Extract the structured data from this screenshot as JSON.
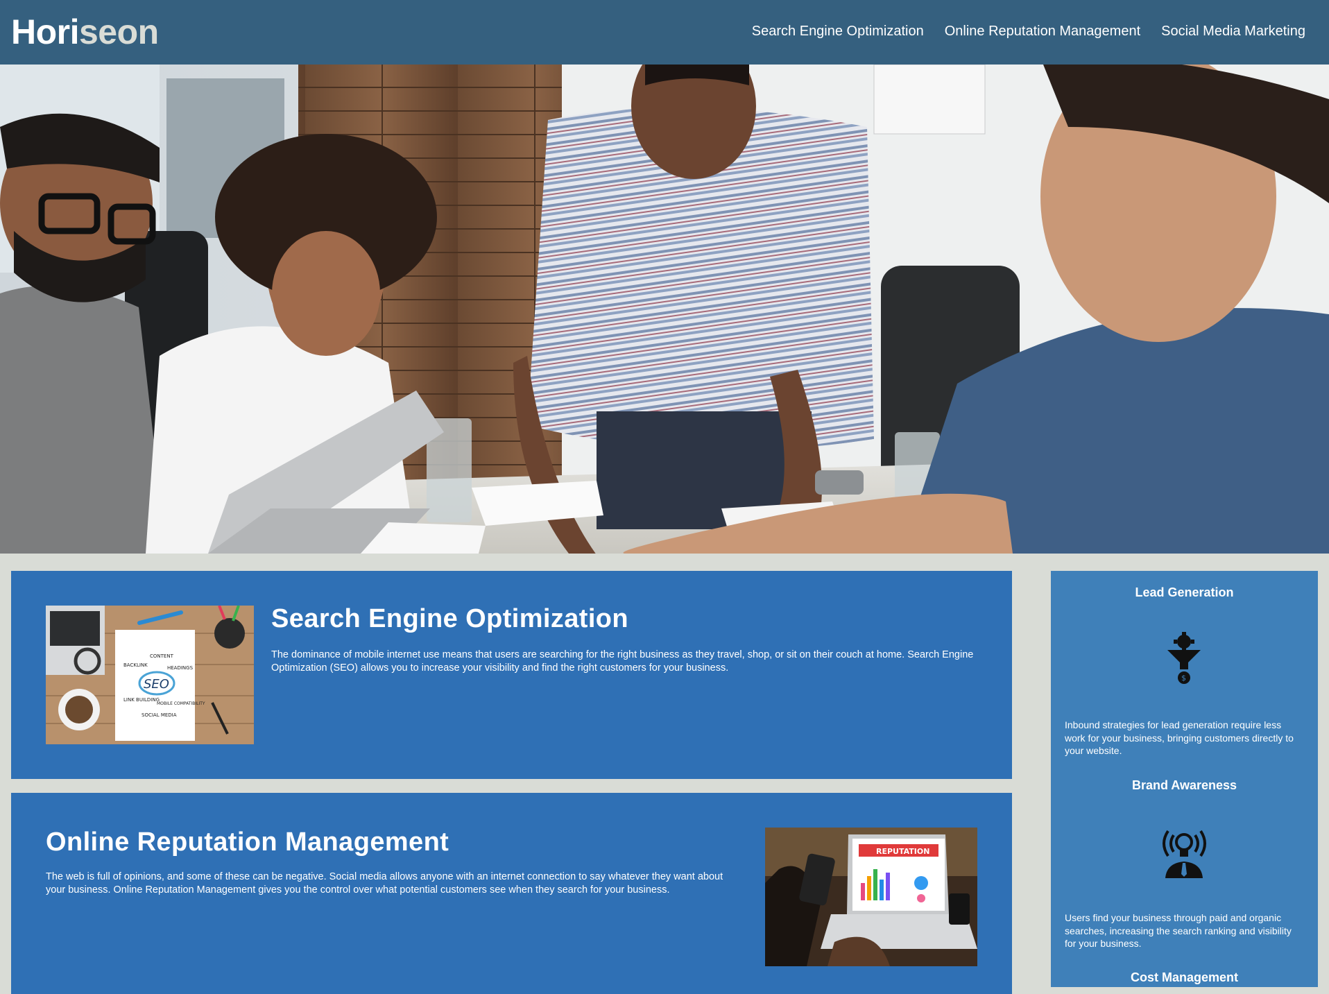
{
  "header": {
    "logo_main": "Hori",
    "logo_accent": "seon",
    "nav": [
      "Search Engine Optimization",
      "Online Reputation Management",
      "Social Media Marketing"
    ]
  },
  "hero": {
    "description": "Team of four coworkers gathered around a meeting table with a laptop"
  },
  "sections": {
    "seo": {
      "title": "Search Engine Optimization",
      "text": "The dominance of mobile internet use means that users are searching for the right business as they travel, shop, or sit on their couch at home. Search Engine Optimization (SEO) allows you to increase your visibility and find the right customers for your business.",
      "image_labels": [
        "CONTENT",
        "BACKLINK",
        "HEADINGS",
        "SEO",
        "LINK BUILDING",
        "MOBILE COMPATIBILITY",
        "SOCIAL MEDIA"
      ]
    },
    "orm": {
      "title": "Online Reputation Management",
      "text": "The web is full of opinions, and some of these can be negative. Social media allows anyone with an internet connection to say whatever they want about your business. Online Reputation Management gives you the control over what potential customers see when they search for your business.",
      "image_label": "REPUTATION"
    }
  },
  "benefits": [
    {
      "title": "Lead Generation",
      "icon": "lead-generation-funnel-icon",
      "text": "Inbound strategies for lead generation require less work for your business, bringing customers directly to your website."
    },
    {
      "title": "Brand Awareness",
      "icon": "brand-awareness-broadcast-icon",
      "text": "Users find your business through paid and organic searches, increasing the search ranking and visibility for your business."
    },
    {
      "title": "Cost Management",
      "icon": "",
      "text": ""
    }
  ],
  "colors": {
    "header_bg": "#35607f",
    "page_bg": "#d9dcd6",
    "card_bg": "#2f70b5",
    "aside_bg": "#3f80b9"
  }
}
